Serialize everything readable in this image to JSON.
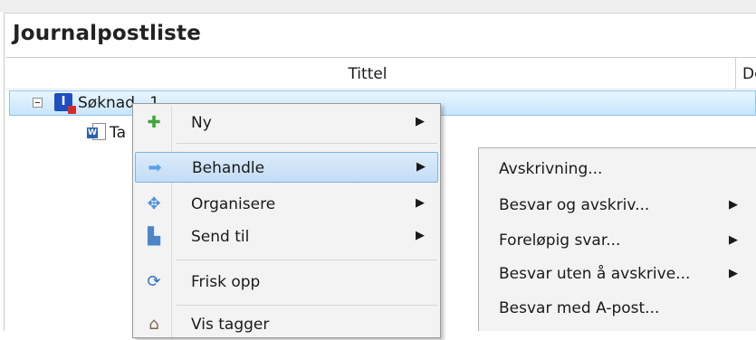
{
  "panel": {
    "title": "Journalpostliste"
  },
  "columns": {
    "title": "Tittel",
    "next": "Dc"
  },
  "tree": {
    "row1_label": "Søknad...1",
    "row1_icon_letter": "I",
    "row2_label": "Ta"
  },
  "context_menu": {
    "items": [
      {
        "label": "Ny",
        "icon": "plus-icon",
        "submenu": "▶"
      },
      {
        "label": "Behandle",
        "icon": "arrow-right-icon",
        "submenu": "▶"
      },
      {
        "label": "Organisere",
        "icon": "move-icon",
        "submenu": "▶"
      },
      {
        "label": "Send til",
        "icon": "send-to-icon",
        "submenu": "▶"
      },
      {
        "label": "Frisk opp",
        "icon": "refresh-icon"
      },
      {
        "label": "Vis tagger",
        "icon": "tag-icon"
      }
    ]
  },
  "submenu": {
    "items": [
      {
        "label": "Avskrivning..."
      },
      {
        "label": "Besvar og avskriv...",
        "submenu": "▶"
      },
      {
        "label": "Foreløpig svar...",
        "submenu": "▶"
      },
      {
        "label": "Besvar uten å avskrive...",
        "submenu": "▶"
      },
      {
        "label": "Besvar med A-post..."
      }
    ]
  },
  "colors": {
    "highlight": "#c7e5fb",
    "accent": "#1f4fbf"
  }
}
